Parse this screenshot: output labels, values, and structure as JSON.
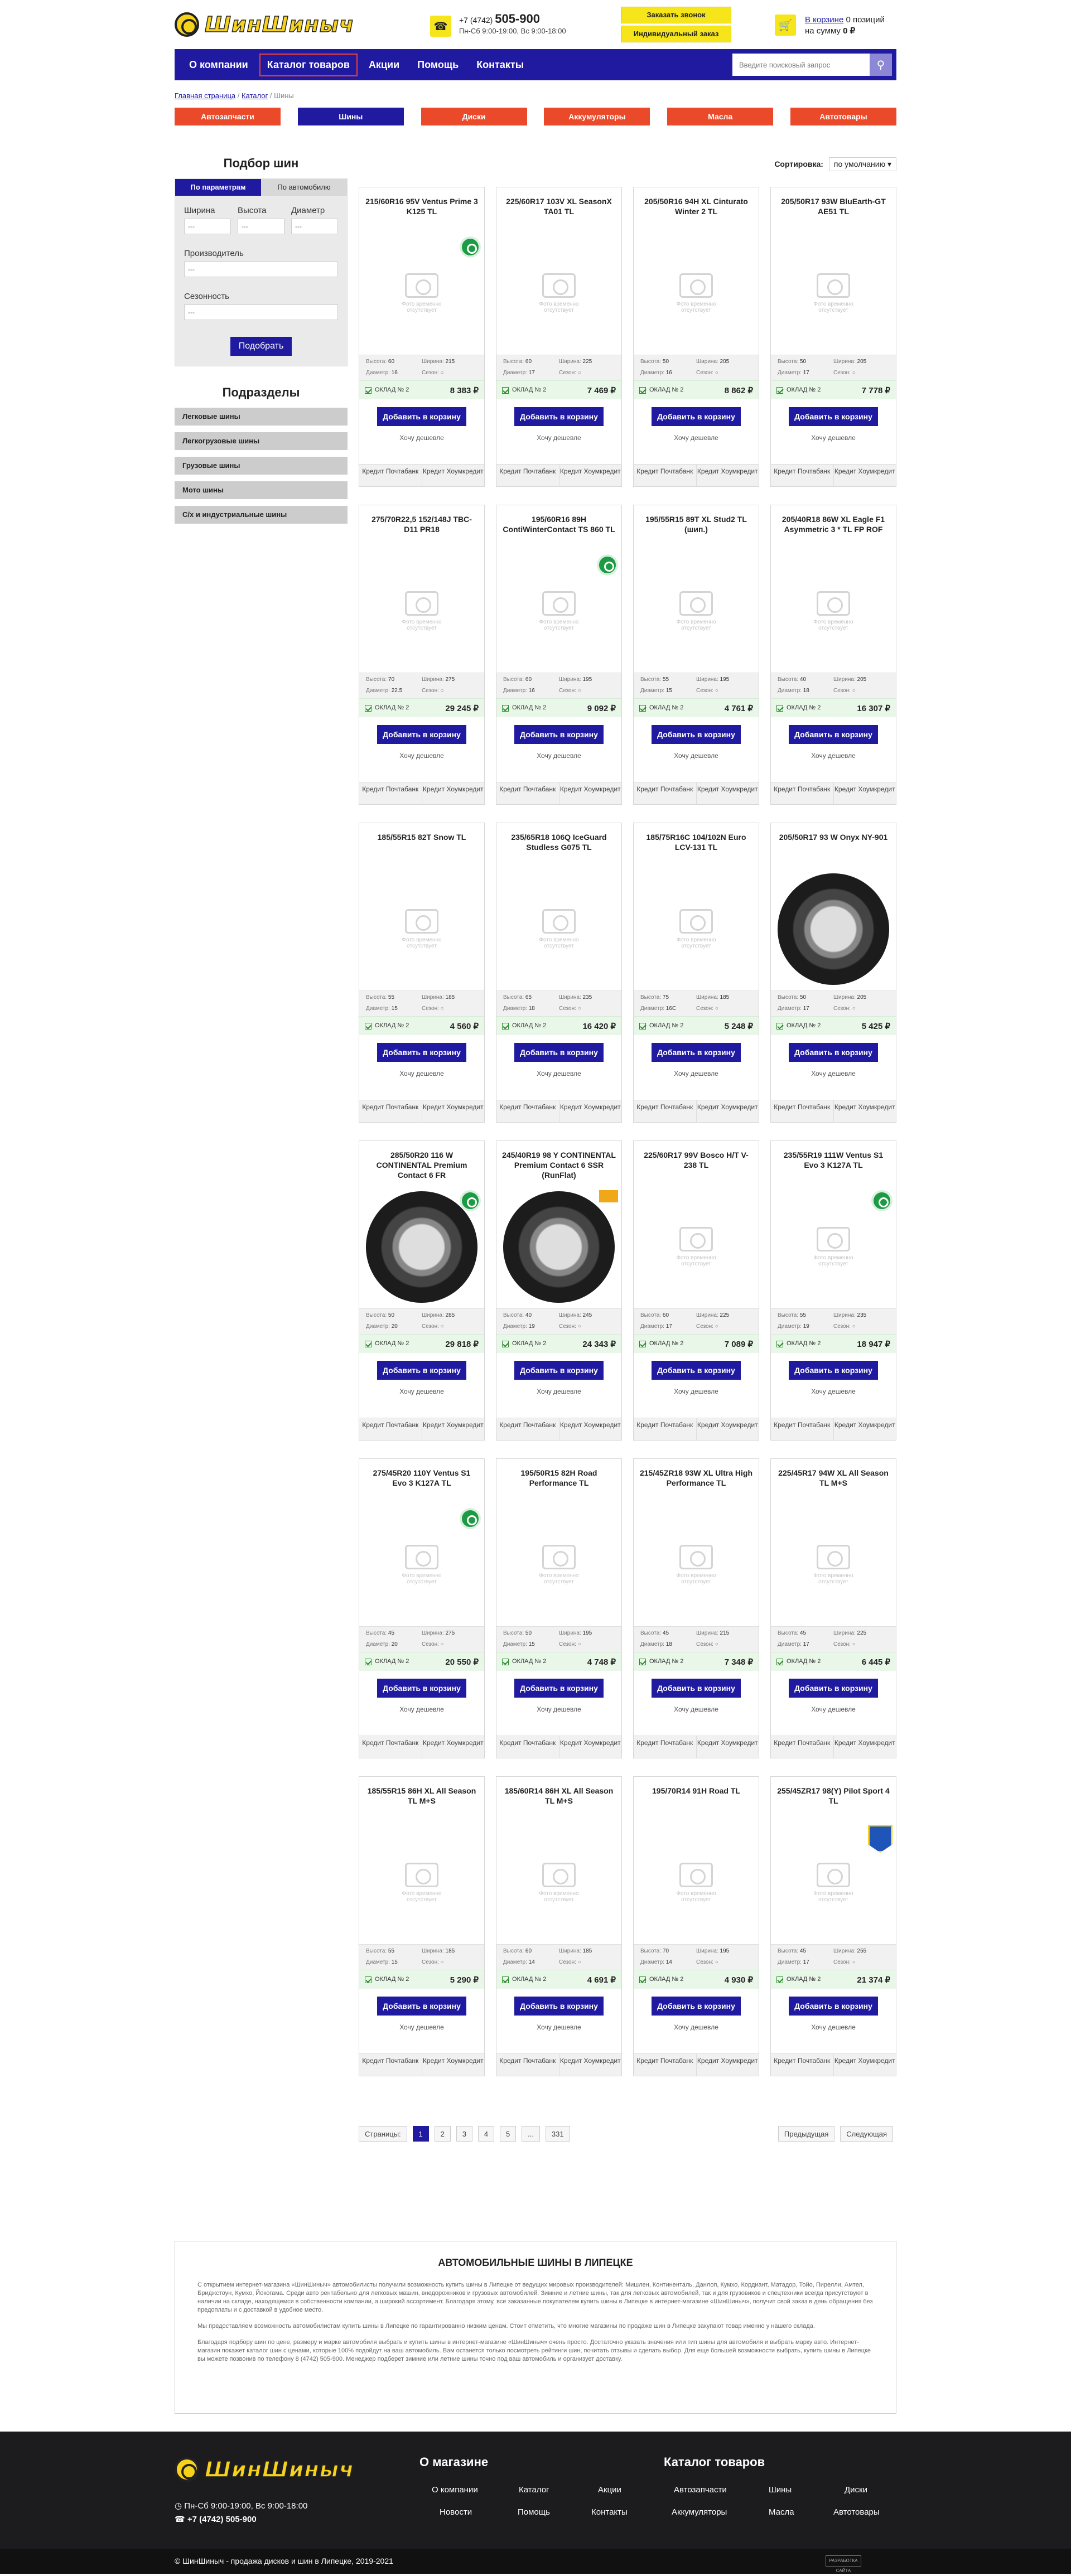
{
  "header": {
    "logo_text": "ШинШиныч",
    "phone_prefix": "+7 (4742)",
    "phone_number": "505-900",
    "hours": "Пн-Сб 9:00-19:00, Вс 9:00-18:00",
    "call_button": "Заказать звонок",
    "custom_order_button": "Индивидуальный заказ",
    "cart_link": "В корзине",
    "cart_count": "0 позиций",
    "cart_sum_label": "на сумму",
    "cart_sum": "0 ₽"
  },
  "nav": {
    "items": [
      "О компании",
      "Каталог товаров",
      "Акции",
      "Помощь",
      "Контакты"
    ],
    "search_placeholder": "Введите поисковый запрос"
  },
  "breadcrumbs": [
    "Главная страница",
    "Каталог",
    "Шины"
  ],
  "categories": [
    "Автозапчасти",
    "Шины",
    "Диски",
    "Аккумуляторы",
    "Масла",
    "Автотовары"
  ],
  "sidebar": {
    "title": "Подбор шин",
    "tab_params": "По параметрам",
    "tab_car": "По автомобилю",
    "width": "Ширина",
    "height": "Высота",
    "diameter": "Диаметр",
    "dash": "---",
    "maker": "Производитель",
    "season": "Сезонность",
    "submit": "Подобрать",
    "sub_title": "Подразделы",
    "links": [
      "Легковые шины",
      "Легкогрузовые шины",
      "Грузовые шины",
      "Мото шины",
      "С/х и индустриальные шины"
    ]
  },
  "sort": {
    "label": "Сортировка:",
    "value": "по умолчанию"
  },
  "card_text": {
    "placeholder": "Фото временно отсутствует",
    "height": "Высота:",
    "width": "Ширина:",
    "diameter": "Диаметр:",
    "season": "Сезон:",
    "add": "Добавить в корзину",
    "want_cheaper": "Хочу дешевле",
    "credit": "Кредит Почтабанк",
    "credit2": "Кредит Хоумкредит"
  },
  "products": [
    {
      "title": "215/60R16 95V Ventus Prime 3 K125 TL",
      "h": "60",
      "w": "215",
      "d": "16",
      "stock": "ОКЛАД № 2",
      "price": "8 383 ₽",
      "badge": "green"
    },
    {
      "title": "225/60R17 103V XL SeasonX TA01 TL",
      "h": "60",
      "w": "225",
      "d": "17",
      "stock": "ОКЛАД № 2",
      "price": "7 469 ₽",
      "badge": ""
    },
    {
      "title": "205/50R16 94H XL Cinturato Winter 2 TL",
      "h": "50",
      "w": "205",
      "d": "16",
      "stock": "ОКЛАД № 2",
      "price": "8 862 ₽",
      "badge": ""
    },
    {
      "title": "205/50R17 93W BluEarth-GT AE51 TL",
      "h": "50",
      "w": "205",
      "d": "17",
      "stock": "ОКЛАД № 2",
      "price": "7 778 ₽",
      "badge": ""
    },
    {
      "title": "275/70R22,5 152/148J TBC-D11 PR18",
      "h": "70",
      "w": "275",
      "d": "22.5",
      "stock": "ОКЛАД № 2",
      "price": "29 245 ₽",
      "badge": ""
    },
    {
      "title": "195/60R16 89H ContiWinterContact TS 860 TL",
      "h": "60",
      "w": "195",
      "d": "16",
      "stock": "ОКЛАД № 2",
      "price": "9 092 ₽",
      "badge": "green"
    },
    {
      "title": "195/55R15 89T XL Stud2 TL (шип.)",
      "h": "55",
      "w": "195",
      "d": "15",
      "stock": "ОКЛАД № 2",
      "price": "4 761 ₽",
      "badge": ""
    },
    {
      "title": "205/40R18 86W XL Eagle F1 Asymmetric 3 * TL FP ROF",
      "h": "40",
      "w": "205",
      "d": "18",
      "stock": "ОКЛАД № 2",
      "price": "16 307 ₽",
      "badge": ""
    },
    {
      "title": "185/55R15 82T Snow TL",
      "h": "55",
      "w": "185",
      "d": "15",
      "stock": "ОКЛАД № 2",
      "price": "4 560 ₽",
      "badge": ""
    },
    {
      "title": "235/65R18 106Q IceGuard Studless G075 TL",
      "h": "65",
      "w": "235",
      "d": "18",
      "stock": "ОКЛАД № 2",
      "price": "16 420 ₽",
      "badge": ""
    },
    {
      "title": "185/75R16C 104/102N Euro LCV-131 TL",
      "h": "75",
      "w": "185",
      "d": "16C",
      "stock": "ОКЛАД № 2",
      "price": "5 248 ₽",
      "badge": ""
    },
    {
      "title": "205/50R17 93 W Onyx NY-901",
      "h": "50",
      "w": "205",
      "d": "17",
      "stock": "ОКЛАД № 2",
      "price": "5 425 ₽",
      "badge": "",
      "tyre": true
    },
    {
      "title": "285/50R20 116 W CONTINENTAL Premium Contact 6 FR",
      "h": "50",
      "w": "285",
      "d": "20",
      "stock": "ОКЛАД № 2",
      "price": "29 818 ₽",
      "badge": "green",
      "tyre": true
    },
    {
      "title": "245/40R19 98 Y CONTINENTAL Premium Contact 6 SSR (RunFlat)",
      "h": "40",
      "w": "245",
      "d": "19",
      "stock": "ОКЛАД № 2",
      "price": "24 343 ₽",
      "badge": "yellow",
      "tyre": true
    },
    {
      "title": "225/60R17 99V Bosco H/T V-238 TL",
      "h": "60",
      "w": "225",
      "d": "17",
      "stock": "ОКЛАД № 2",
      "price": "7 089 ₽",
      "badge": ""
    },
    {
      "title": "235/55R19 111W Ventus S1 Evo 3 K127A TL",
      "h": "55",
      "w": "235",
      "d": "19",
      "stock": "ОКЛАД № 2",
      "price": "18 947 ₽",
      "badge": "green"
    },
    {
      "title": "275/45R20 110Y Ventus S1 Evo 3 K127A TL",
      "h": "45",
      "w": "275",
      "d": "20",
      "stock": "ОКЛАД № 2",
      "price": "20 550 ₽",
      "badge": "green"
    },
    {
      "title": "195/50R15 82H Road Performance TL",
      "h": "50",
      "w": "195",
      "d": "15",
      "stock": "ОКЛАД № 2",
      "price": "4 748 ₽",
      "badge": ""
    },
    {
      "title": "215/45ZR18 93W XL Ultra High Performance TL",
      "h": "45",
      "w": "215",
      "d": "18",
      "stock": "ОКЛАД № 2",
      "price": "7 348 ₽",
      "badge": ""
    },
    {
      "title": "225/45R17 94W XL All Season TL M+S",
      "h": "45",
      "w": "225",
      "d": "17",
      "stock": "ОКЛАД № 2",
      "price": "6 445 ₽",
      "badge": ""
    },
    {
      "title": "185/55R15 86H XL All Season TL M+S",
      "h": "55",
      "w": "185",
      "d": "15",
      "stock": "ОКЛАД № 2",
      "price": "5 290 ₽",
      "badge": ""
    },
    {
      "title": "185/60R14 86H XL All Season TL M+S",
      "h": "60",
      "w": "185",
      "d": "14",
      "stock": "ОКЛАД № 2",
      "price": "4 691 ₽",
      "badge": ""
    },
    {
      "title": "195/70R14 91H Road TL",
      "h": "70",
      "w": "195",
      "d": "14",
      "stock": "ОКЛАД № 2",
      "price": "4 930 ₽",
      "badge": ""
    },
    {
      "title": "255/45ZR17 98(Y) Pilot Sport 4 TL",
      "h": "45",
      "w": "255",
      "d": "17",
      "stock": "ОКЛАД № 2",
      "price": "21 374 ₽",
      "badge": "blue"
    }
  ],
  "pager": {
    "label": "Страницы:",
    "pages": [
      "1",
      "2",
      "3",
      "4",
      "5",
      "...",
      "331"
    ],
    "prev": "Предыдущая",
    "next": "Следующая"
  },
  "seo": {
    "title": "АВТОМОБИЛЬНЫЕ ШИНЫ В ЛИПЕЦКЕ",
    "p1": "С открытием интернет-магазина «ШинШиныч» автомобилисты получили возможность купить шины в Липецке от ведущих мировых производителей: Мишлен, Континенталь, Данлоп, Кумхо, Кордиант, Матадор, Тойо, Пирелли, Амтел, Бриджстоун, Кумхо, Йокогама. Среди авто рентабельно для легковых машин, внедорожников и грузовых автомобилей. Зимние и летние шины, так для легковых автомобилей, так и для грузовиков и спецтехники всегда присутствуют в наличии на складе, находящемся в собственности компании, а широкий ассортимент. Благодаря этому, все заказанные покупателем купить шины в Липецке в интернет-магазине «ШинШиныч», получит свой заказ в день обращения без предоплаты и с доставкой в удобное место.",
    "p2": "Мы предоставляем возможность автомобилистам купить шины в Липецке по гарантированно низким ценам. Стоит отметить, что многие магазины по продаже шин в Липецке закупают товар именно у нашего склада.",
    "p3": "Благодаря подбору шин по цене, размеру и марке автомобиля выбрать и купить шины в интернет-магазине «ШинШиныч» очень просто. Достаточно указать значения или тип шины для автомобиля и выбрать марку авто. Интернет-магазин покажет каталог шин с ценами, которые 100% подойдут на ваш автомобиль. Вам останется только посмотреть рейтинги шин, почитать отзывы и сделать выбор. Для еще большей возможности выбрать, купить шины в Липецке вы можете позвонив по телефону 8 (4742) 505-900. Менеджер подберет зимние или летние шины точно под ваш автомобиль и организует доставку."
  },
  "footer": {
    "logo_text": "ШинШиныч",
    "hours": "Пн-Сб 9:00-19:00, Вс 9:00-18:00",
    "phone": "+7 (4742) 505-900",
    "about_title": "О магазине",
    "about_links": [
      "О компании",
      "Каталог",
      "Акции",
      "Новости",
      "Помощь",
      "Контакты"
    ],
    "catalog_title": "Каталог товаров",
    "catalog_links": [
      "Автозапчасти",
      "Шины",
      "Диски",
      "Аккумуляторы",
      "Масла",
      "Автотовары"
    ],
    "copyright": "© ШинШиныч - продажа дисков и шин в Липецке, 2019-2021",
    "dev": "РАЗРАБОТКА САЙТА"
  }
}
